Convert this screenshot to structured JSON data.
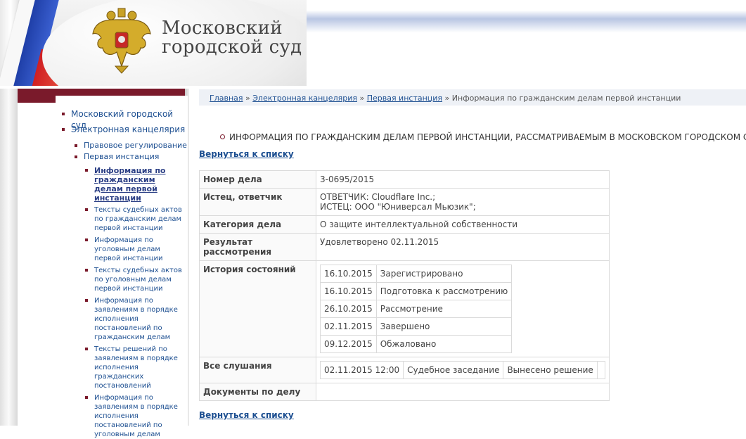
{
  "header": {
    "title_line1": "Московский",
    "title_line2": "городской суд",
    "colors": {
      "flag_white": "#f8f8f8",
      "flag_blue": "#1f3fa8",
      "flag_red": "#d01f22",
      "accent": "#7a1a2b"
    }
  },
  "sidebar": {
    "items": [
      {
        "label": "Московский городской суд",
        "level": 1
      },
      {
        "label": "Электронная канцелярия",
        "level": 1
      },
      {
        "label": "Правовое регулирование",
        "level": 2
      },
      {
        "label": "Первая инстанция",
        "level": 2
      },
      {
        "label": "Информация по гражданским делам первой инстанции",
        "level": 3,
        "active": true
      },
      {
        "label": "Тексты судебных актов по гражданским делам первой инстанции",
        "level": 3
      },
      {
        "label": "Информация по уголовным делам первой инстанции",
        "level": 3
      },
      {
        "label": "Тексты судебных актов по уголовным делам первой инстанции",
        "level": 3
      },
      {
        "label": "Информация по заявлениям в порядке исполнения постановлений по гражданским делам",
        "level": 3
      },
      {
        "label": "Тексты решений по заявлениям в порядке исполнения гражданских постановлений",
        "level": 3
      },
      {
        "label": "Информация по заявлениям в порядке исполнения постановлений по уголовным делам",
        "level": 3
      }
    ]
  },
  "breadcrumb": {
    "home": "Главная",
    "sep": "»",
    "chancery": "Электронная канцелярия",
    "first_instance": "Первая инстанция",
    "current": "Информация по гражданским делам первой инстанции"
  },
  "page": {
    "heading": "ИНФОРМАЦИЯ ПО ГРАЖДАНСКИМ ДЕЛАМ ПЕРВОЙ ИНСТАНЦИИ, РАССМАТРИВАЕМЫМ В МОСКОВСКОМ ГОРОДСКОМ СУДЕ",
    "back_link": "Вернуться к списку"
  },
  "case": {
    "number_label": "Номер дела",
    "number": "3-0695/2015",
    "parties_label": "Истец, ответчик",
    "defendant": "ОТВЕТЧИК: Cloudflare Inc.;",
    "plaintiff": "ИСТЕЦ: ООО \"Юниверсал Мьюзик\";",
    "category_label": "Категория дела",
    "category": "О защите интеллектуальной собственности",
    "result_label": "Результат рассмотрения",
    "result": "Удовлетворено 02.11.2015",
    "history_label": "История состояний",
    "history": [
      {
        "date": "16.10.2015",
        "status": "Зарегистрировано"
      },
      {
        "date": "16.10.2015",
        "status": "Подготовка к рассмотрению"
      },
      {
        "date": "26.10.2015",
        "status": "Рассмотрение"
      },
      {
        "date": "02.11.2015",
        "status": "Завершено"
      },
      {
        "date": "09.12.2015",
        "status": "Обжаловано"
      }
    ],
    "hearings_label": "Все слушания",
    "hearing": {
      "datetime": "02.11.2015 12:00",
      "type": "Судебное заседание",
      "result": "Вынесено решение",
      "extra": ""
    },
    "documents_label": "Документы по делу",
    "documents": ""
  }
}
